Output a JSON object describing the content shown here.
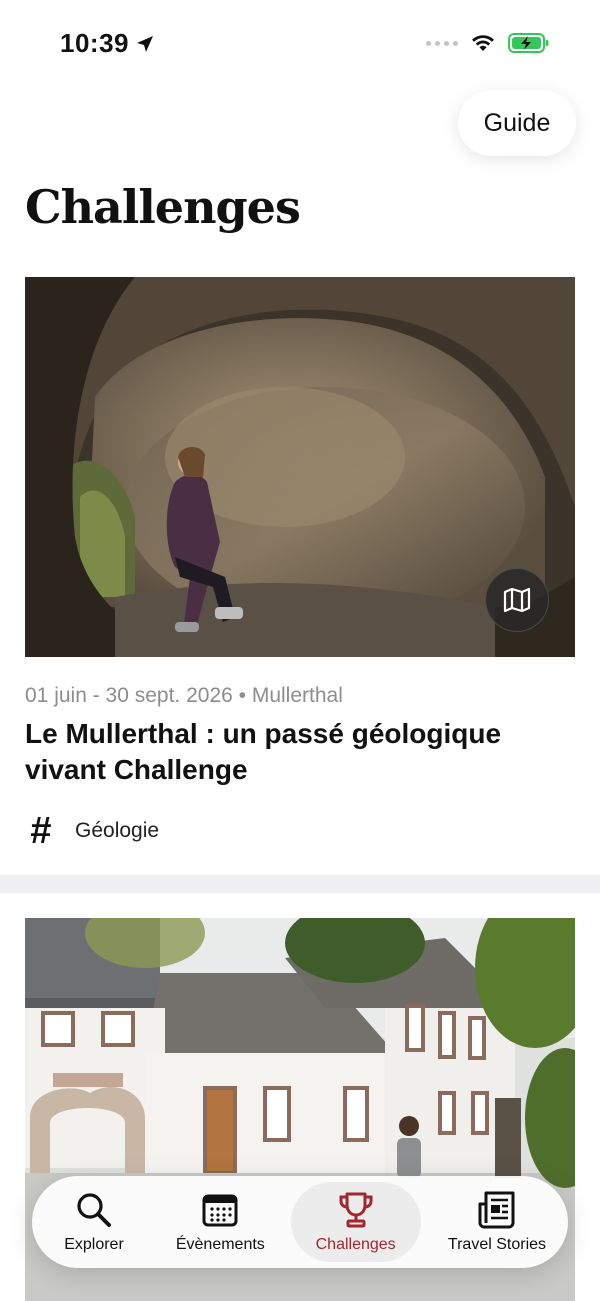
{
  "status_bar": {
    "time": "10:39",
    "location_icon": "location-arrow-icon",
    "signal_icon": "signal-dots-icon",
    "wifi_icon": "wifi-icon",
    "battery_icon": "battery-charging-icon",
    "battery_color": "#34c759"
  },
  "header": {
    "guide_label": "Guide",
    "title": "Challenges"
  },
  "cards": [
    {
      "meta": "01 juin - 30 sept. 2026 • Mullerthal",
      "title": "Le Mullerthal : un passé géologique vivant Challenge",
      "tag_icon": "hashtag-icon",
      "tag": "Géologie",
      "map_icon": "map-icon",
      "image": "photo-hiker-in-sandstone-cave"
    },
    {
      "image": "photo-white-village-building"
    }
  ],
  "bottom_nav": {
    "active_color": "#a4262c",
    "items": [
      {
        "label": "Explorer",
        "icon": "search-icon",
        "active": false
      },
      {
        "label": "Évènements",
        "icon": "calendar-icon",
        "active": false
      },
      {
        "label": "Challenges",
        "icon": "trophy-icon",
        "active": true
      },
      {
        "label": "Travel Stories",
        "icon": "newspaper-icon",
        "active": false
      }
    ]
  }
}
